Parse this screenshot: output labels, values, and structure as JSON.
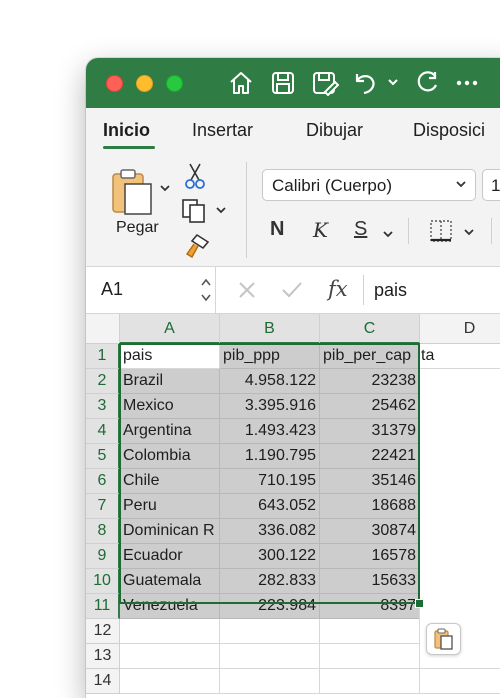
{
  "tabs": [
    {
      "label": "Inicio",
      "active": true
    },
    {
      "label": "Insertar",
      "active": false
    },
    {
      "label": "Dibujar",
      "active": false
    },
    {
      "label": "Disposici",
      "active": false
    }
  ],
  "ribbon": {
    "paste_label": "Pegar",
    "font_name": "Calibri (Cuerpo)",
    "font_size": "1",
    "bold": "N",
    "italic": "K",
    "underline": "S"
  },
  "formula_bar": {
    "name_box": "A1",
    "fx": "fx",
    "content": "pais"
  },
  "columns": [
    "A",
    "B",
    "C",
    "D"
  ],
  "rows": [
    "1",
    "2",
    "3",
    "4",
    "5",
    "6",
    "7",
    "8",
    "9",
    "10",
    "11",
    "12",
    "13",
    "14"
  ],
  "table": {
    "headers": [
      "pais",
      "pib_ppp",
      "pib_per_cap"
    ],
    "overflow_text": "ta",
    "records": [
      [
        "Brazil",
        "4.958.122",
        "23238"
      ],
      [
        "Mexico",
        "3.395.916",
        "25462"
      ],
      [
        "Argentina",
        "1.493.423",
        "31379"
      ],
      [
        "Colombia",
        "1.190.795",
        "22421"
      ],
      [
        "Chile",
        "710.195",
        "35146"
      ],
      [
        "Peru",
        "643.052",
        "18688"
      ],
      [
        "Dominican R",
        "336.082",
        "30874"
      ],
      [
        "Ecuador",
        "300.122",
        "16578"
      ],
      [
        "Guatemala",
        "282.833",
        "15633"
      ],
      [
        "Venezuela",
        "223.984",
        "8397"
      ]
    ]
  },
  "colors": {
    "title_bar": "#2f7d44",
    "selection": "#1e6b36",
    "shade": "#cdcdcd"
  },
  "icons": [
    "home-icon",
    "save-icon",
    "save-as-icon",
    "undo-icon",
    "redo-icon",
    "more-icon",
    "paste-icon",
    "cut-icon",
    "copy-icon",
    "format-painter-icon",
    "borders-icon",
    "paste-options-icon"
  ]
}
